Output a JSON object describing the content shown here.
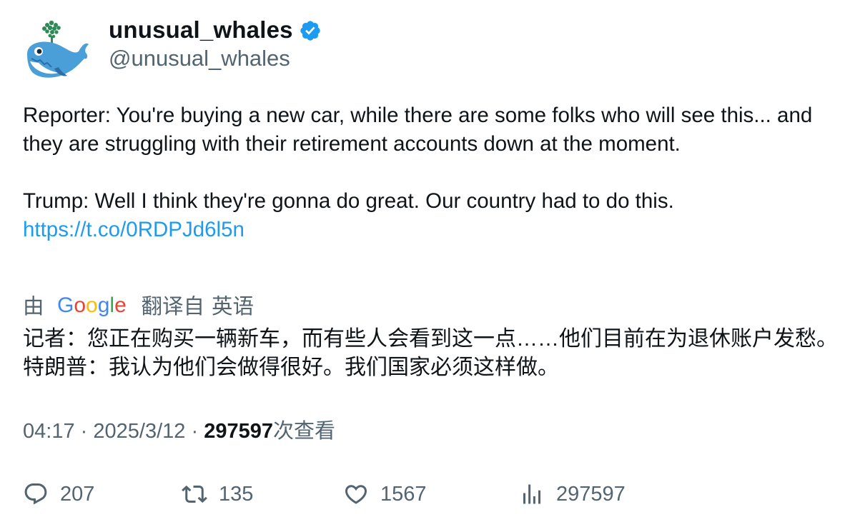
{
  "author": {
    "display_name": "unusual_whales",
    "handle": "@unusual_whales",
    "verified": true,
    "avatar_icon": "whale-logo-icon",
    "verified_color": "#1d9bf0"
  },
  "tweet": {
    "paragraph_1": "Reporter: You're buying a new car, while there are some folks who will see this... and they are struggling with their retirement accounts down at the moment.",
    "paragraph_2": "Trump: Well I think they're gonna do great. Our country had to do this.",
    "link": "https://t.co/0RDPJd6l5n",
    "link_color": "#1d9bf0"
  },
  "translation": {
    "by_label": "由",
    "provider": "Google",
    "translated_from": "翻译自",
    "language": "英语",
    "text": "记者：您正在购买一辆新车，而有些人会看到这一点……他们目前在为退休账户发愁。 特朗普：我认为他们会做得很好。我们国家必须这样做。"
  },
  "meta": {
    "time": "04:17",
    "separator": "·",
    "date": "2025/3/12",
    "views": "297597",
    "views_label": "次查看"
  },
  "actions": {
    "replies": "207",
    "retweets": "135",
    "likes": "1567",
    "views": "297597"
  }
}
